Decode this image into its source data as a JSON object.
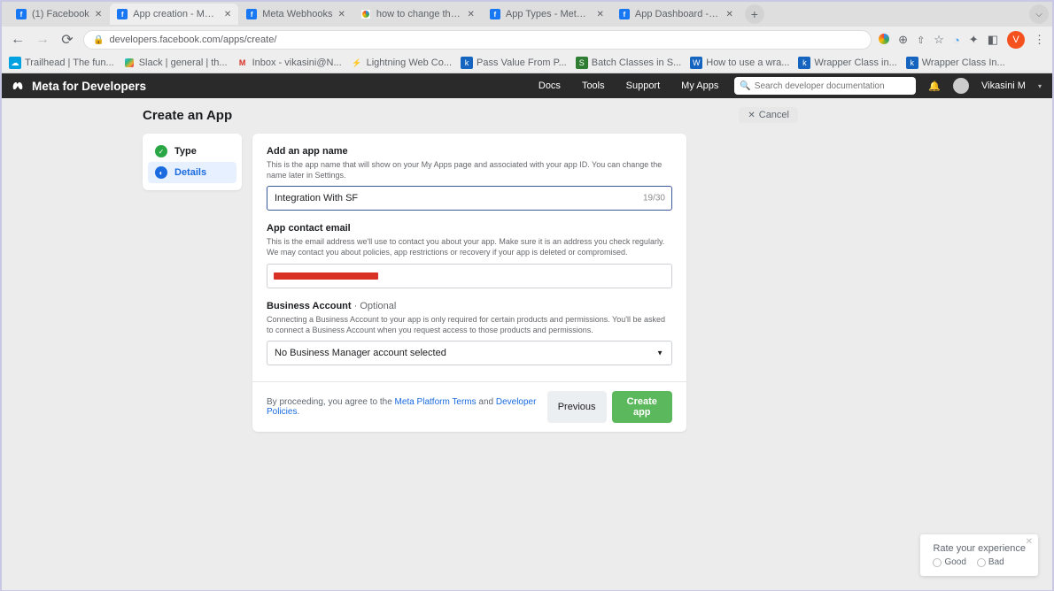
{
  "browser": {
    "tabs": [
      {
        "title": "(1) Facebook",
        "favicon_color": "#1877f2"
      },
      {
        "title": "App creation - Meta for De",
        "favicon_color": "#1877f2",
        "active": true
      },
      {
        "title": "Meta Webhooks",
        "favicon_color": "#1877f2"
      },
      {
        "title": "how to change the app typ",
        "favicon_color": "#fff"
      },
      {
        "title": "App Types - Meta App Dev",
        "favicon_color": "#1877f2"
      },
      {
        "title": "App Dashboard - Meta Ap",
        "favicon_color": "#1877f2"
      }
    ],
    "url": "developers.facebook.com/apps/create/",
    "avatar_letter": "V"
  },
  "bookmarks": [
    {
      "label": "Trailhead | The fun..."
    },
    {
      "label": "Slack | general | th..."
    },
    {
      "label": "Inbox - vikasini@N..."
    },
    {
      "label": "Lightning Web Co..."
    },
    {
      "label": "Pass Value From P..."
    },
    {
      "label": "Batch Classes in S..."
    },
    {
      "label": "How to use a wra..."
    },
    {
      "label": "Wrapper Class in..."
    },
    {
      "label": "Wrapper Class In..."
    }
  ],
  "meta_nav": {
    "brand": "Meta for Developers",
    "links": {
      "docs": "Docs",
      "tools": "Tools",
      "support": "Support",
      "myapps": "My Apps"
    },
    "search_placeholder": "Search developer documentation",
    "username": "Vikasini M"
  },
  "page": {
    "title": "Create an App",
    "cancel": "Cancel",
    "steps": {
      "type": "Type",
      "details": "Details"
    }
  },
  "form": {
    "app_name": {
      "label": "Add an app name",
      "help": "This is the app name that will show on your My Apps page and associated with your app ID. You can change the name later in Settings.",
      "value": "Integration With SF",
      "counter": "19/30"
    },
    "contact_email": {
      "label": "App contact email",
      "help": "This is the email address we'll use to contact you about your app. Make sure it is an address you check regularly. We may contact you about policies, app restrictions or recovery if your app is deleted or compromised."
    },
    "business_account": {
      "label": "Business Account",
      "optional": " · Optional",
      "help": "Connecting a Business Account to your app is only required for certain products and permissions. You'll be asked to connect a Business Account when you request access to those products and permissions.",
      "selected": "No Business Manager account selected"
    },
    "footer": {
      "prefix": "By proceeding, you agree to the ",
      "link1": "Meta Platform Terms",
      "mid": " and ",
      "link2": "Developer Policies",
      "suffix": "."
    },
    "buttons": {
      "previous": "Previous",
      "create": "Create app"
    }
  },
  "feedback": {
    "title": "Rate your experience",
    "good": "Good",
    "bad": "Bad"
  }
}
